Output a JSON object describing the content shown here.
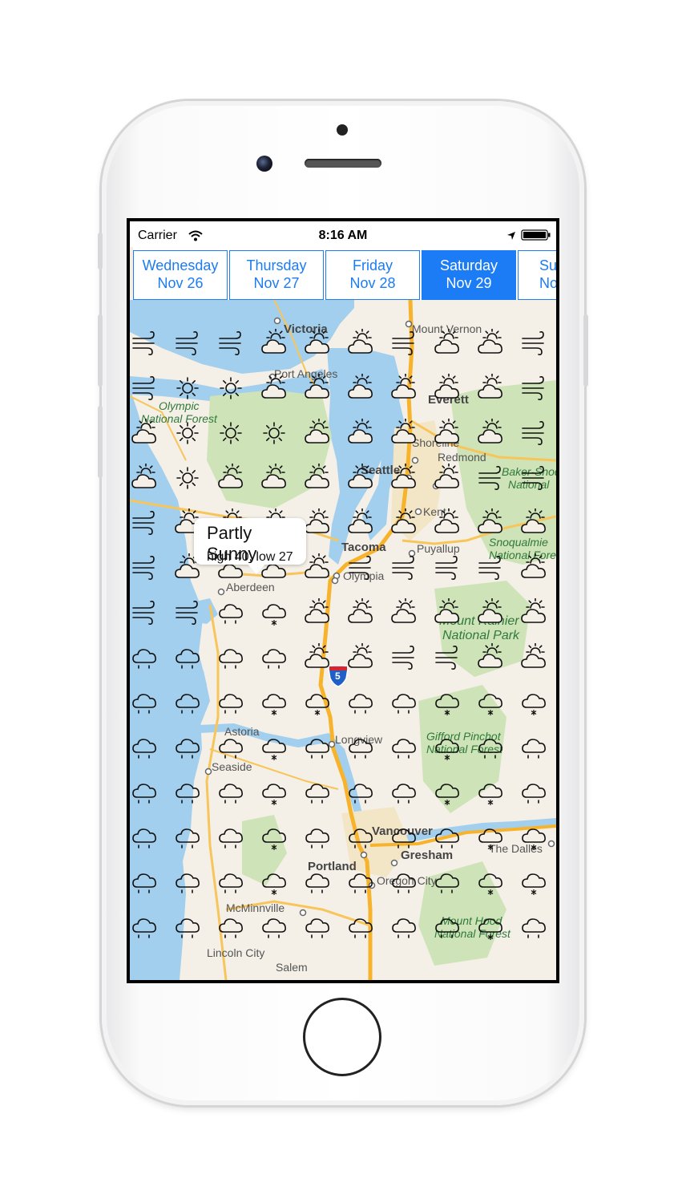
{
  "status_bar": {
    "carrier": "Carrier",
    "time": "8:16 AM"
  },
  "day_tabs": [
    {
      "day": "Wednesday",
      "date": "Nov 26",
      "selected": false
    },
    {
      "day": "Thursday",
      "date": "Nov 27",
      "selected": false
    },
    {
      "day": "Friday",
      "date": "Nov 28",
      "selected": false
    },
    {
      "day": "Saturday",
      "date": "Nov 29",
      "selected": true
    },
    {
      "day": "Su",
      "date": "No",
      "selected": false
    }
  ],
  "callout": {
    "title": "Partly Sunny",
    "subtitle": "high 40, low 27"
  },
  "map_labels": {
    "victoria": "Victoria",
    "mount_vernon": "Mount Vernon",
    "port_angeles": "Port Angeles",
    "everett": "Everett",
    "olympic_nf": "Olympic",
    "olympic_nf2": "National Forest",
    "shoreline": "Shoreline",
    "redmond": "Redmond",
    "seattle": "Seattle",
    "baker": "Baker-Snoq",
    "baker2": "National",
    "kent": "Kent",
    "tacoma": "Tacoma",
    "puyallup": "Puyallup",
    "snoqualmie": "Snoqualmie",
    "snoqualmie2": "National Fore",
    "olympia": "Olympia",
    "aberdeen": "Aberdeen",
    "rainier": "Mount Rainier",
    "rainier2": "National Park",
    "astoria": "Astoria",
    "longview": "Longview",
    "gifford": "Gifford Pinchot",
    "gifford2": "National Forest",
    "seaside": "Seaside",
    "vancouver": "Vancouver",
    "the_dalles": "The Dalles",
    "gresham": "Gresham",
    "portland": "Portland",
    "oregon_city": "Oregon City",
    "mcminnville": "McMinnville",
    "mount_hood": "Mount Hood",
    "mount_hood2": "National Forest",
    "lincoln_city": "Lincoln City",
    "salem": "Salem",
    "interstate": "5"
  },
  "icons": {
    "info": "i",
    "weather_types": [
      "wind",
      "sun",
      "partly-sunny",
      "rain",
      "snow"
    ]
  },
  "weather_grid": [
    [
      "wind",
      "wind",
      "wind",
      "partly-sunny",
      "partly-sunny",
      "partly-sunny",
      "wind",
      "partly-sunny",
      "partly-sunny",
      "wind"
    ],
    [
      "wind",
      "sun",
      "sun",
      "partly-sunny",
      "partly-sunny",
      "partly-sunny",
      "partly-sunny",
      "partly-sunny",
      "partly-sunny",
      "wind"
    ],
    [
      "partly-sunny",
      "sun",
      "sun",
      "sun",
      "partly-sunny",
      "partly-sunny",
      "partly-sunny",
      "partly-sunny",
      "partly-sunny",
      "wind"
    ],
    [
      "partly-sunny",
      "sun",
      "partly-sunny",
      "partly-sunny",
      "partly-sunny",
      "partly-sunny",
      "partly-sunny",
      "partly-sunny",
      "wind",
      "wind"
    ],
    [
      "wind",
      "partly-sunny",
      "partly-sunny",
      "partly-sunny",
      "partly-sunny",
      "partly-sunny",
      "partly-sunny",
      "partly-sunny",
      "partly-sunny",
      "partly-sunny"
    ],
    [
      "wind",
      "partly-sunny",
      "partly-sunny",
      "partly-sunny",
      "partly-sunny",
      "wind",
      "wind",
      "wind",
      "wind",
      "partly-sunny"
    ],
    [
      "wind",
      "wind",
      "rain",
      "snow",
      "partly-sunny",
      "partly-sunny",
      "partly-sunny",
      "partly-sunny",
      "partly-sunny",
      "partly-sunny"
    ],
    [
      "rain",
      "rain",
      "rain",
      "rain",
      "partly-sunny",
      "partly-sunny",
      "wind",
      "wind",
      "partly-sunny",
      "partly-sunny"
    ],
    [
      "rain",
      "rain",
      "rain",
      "snow",
      "snow",
      "rain",
      "rain",
      "snow",
      "snow",
      "snow"
    ],
    [
      "rain",
      "rain",
      "rain",
      "snow",
      "rain",
      "rain",
      "rain",
      "snow",
      "rain",
      "rain"
    ],
    [
      "rain",
      "rain",
      "rain",
      "snow",
      "rain",
      "rain",
      "rain",
      "snow",
      "snow",
      "rain"
    ],
    [
      "rain",
      "rain",
      "rain",
      "snow",
      "rain",
      "rain",
      "rain",
      "rain",
      "snow",
      "snow"
    ],
    [
      "rain",
      "rain",
      "rain",
      "snow",
      "rain",
      "rain",
      "rain",
      "rain",
      "snow",
      "snow"
    ],
    [
      "rain",
      "rain",
      "rain",
      "rain",
      "rain",
      "rain",
      "rain",
      "rain",
      "snow",
      "rain"
    ]
  ]
}
